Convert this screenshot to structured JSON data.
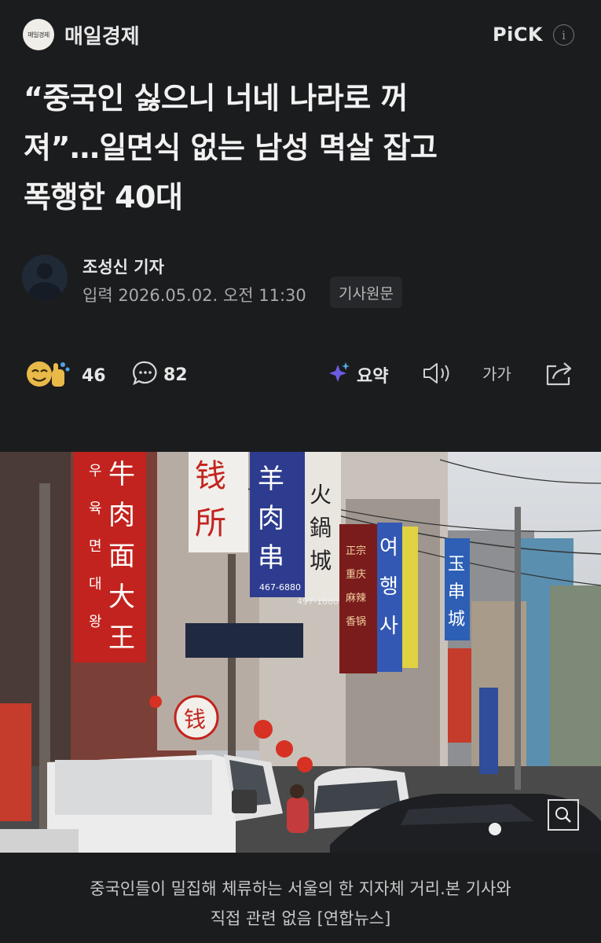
{
  "header": {
    "press_logo_text": "매일경제",
    "press_name": "매일경제",
    "pick_label": "PiCK",
    "info_symbol": "i"
  },
  "article": {
    "headline_line1": "“중국인 싫으니 너네 나라로 꺼",
    "headline_line2": "져”…일면식 없는 남성 멱살 잡고",
    "headline_line3": "폭행한 40대",
    "reporter": "조성신 기자",
    "published": "입력 2026.05.02. 오전 11:30",
    "original_button": "기사원문"
  },
  "actions": {
    "reaction_count": "46",
    "comment_count": "82",
    "summary_label": "요약",
    "font_size_label": "가가"
  },
  "photo": {
    "signs": [
      "우",
      "육",
      "면",
      "대",
      "왕",
      "牛",
      "肉",
      "面",
      "大",
      "王",
      "钱",
      "所",
      "羊",
      "肉",
      "串",
      "火",
      "鍋",
      "城",
      "여",
      "행",
      "사",
      "玉",
      "串",
      "城",
      "钱",
      "467-6880",
      "497-1880",
      "正宗",
      "重庆",
      "麻辣",
      "香锅"
    ]
  },
  "caption": {
    "line1": "중국인들이 밀집해 체류하는 서울의 한 지자체 거리.본 기사와",
    "line2": "직접 관련 없음 [연합뉴스]"
  },
  "colors": {
    "background": "#1b1c1e",
    "text": "#e6e6e6",
    "muted": "#a9a9a9",
    "summary_icon": "#5b5bd6"
  }
}
